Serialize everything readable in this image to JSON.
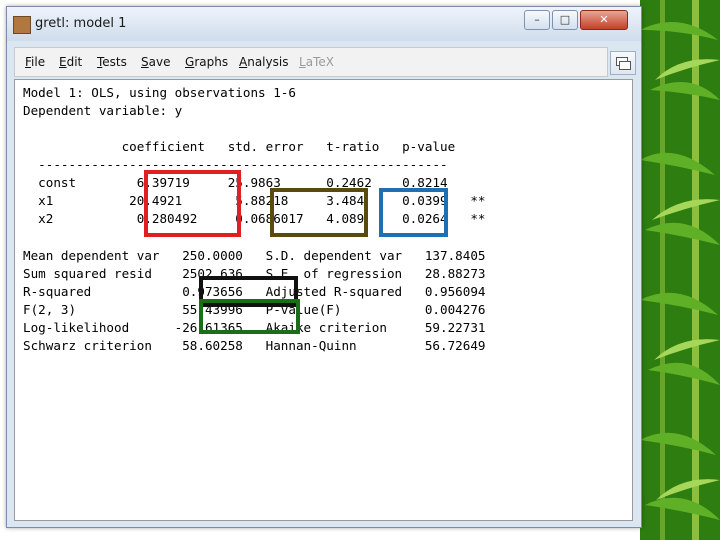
{
  "window": {
    "title": "gretl: model 1",
    "close_label": "✕"
  },
  "menubar": {
    "items": [
      {
        "label": "File",
        "u": "F",
        "rest": "ile"
      },
      {
        "label": "Edit",
        "u": "E",
        "rest": "dit"
      },
      {
        "label": "Tests",
        "u": "T",
        "rest": "ests"
      },
      {
        "label": "Save",
        "u": "S",
        "rest": "ave"
      },
      {
        "label": "Graphs",
        "u": "G",
        "rest": "raphs"
      },
      {
        "label": "Analysis",
        "u": "A",
        "rest": "nalysis"
      },
      {
        "label": "LaTeX",
        "u": "L",
        "rest": "aTeX"
      }
    ]
  },
  "output": {
    "lines": [
      "Model 1: OLS, using observations 1-6",
      "Dependent variable: y",
      "",
      "             coefficient   std. error   t-ratio   p-value",
      "  ------------------------------------------------------",
      "  const        6.39719     25.9863      0.2462    0.8214",
      "  x1          20.4921       5.88218     3.484     0.0399   **",
      "  x2           0.280492     0.0686017   4.089     0.0264   **",
      "",
      "Mean dependent var   250.0000   S.D. dependent var   137.8405",
      "Sum squared resid    2502.636   S.E. of regression   28.88273",
      "R-squared            0.973656   Adjusted R-squared   0.956094",
      "F(2, 3)              55.43996   P-value(F)           0.004276",
      "Log-likelihood      -26.61365   Akaike criterion     59.22731",
      "Schwarz criterion    58.60258   Hannan-Quinn         56.72649"
    ]
  },
  "highlight_colors": {
    "coefficient_box": "#e02020",
    "std_error_box": "#5a4a10",
    "t_ratio_box": "#1f6fb5",
    "r_squared_box": "#111111",
    "f_stat_box": "#1a6e1a"
  }
}
